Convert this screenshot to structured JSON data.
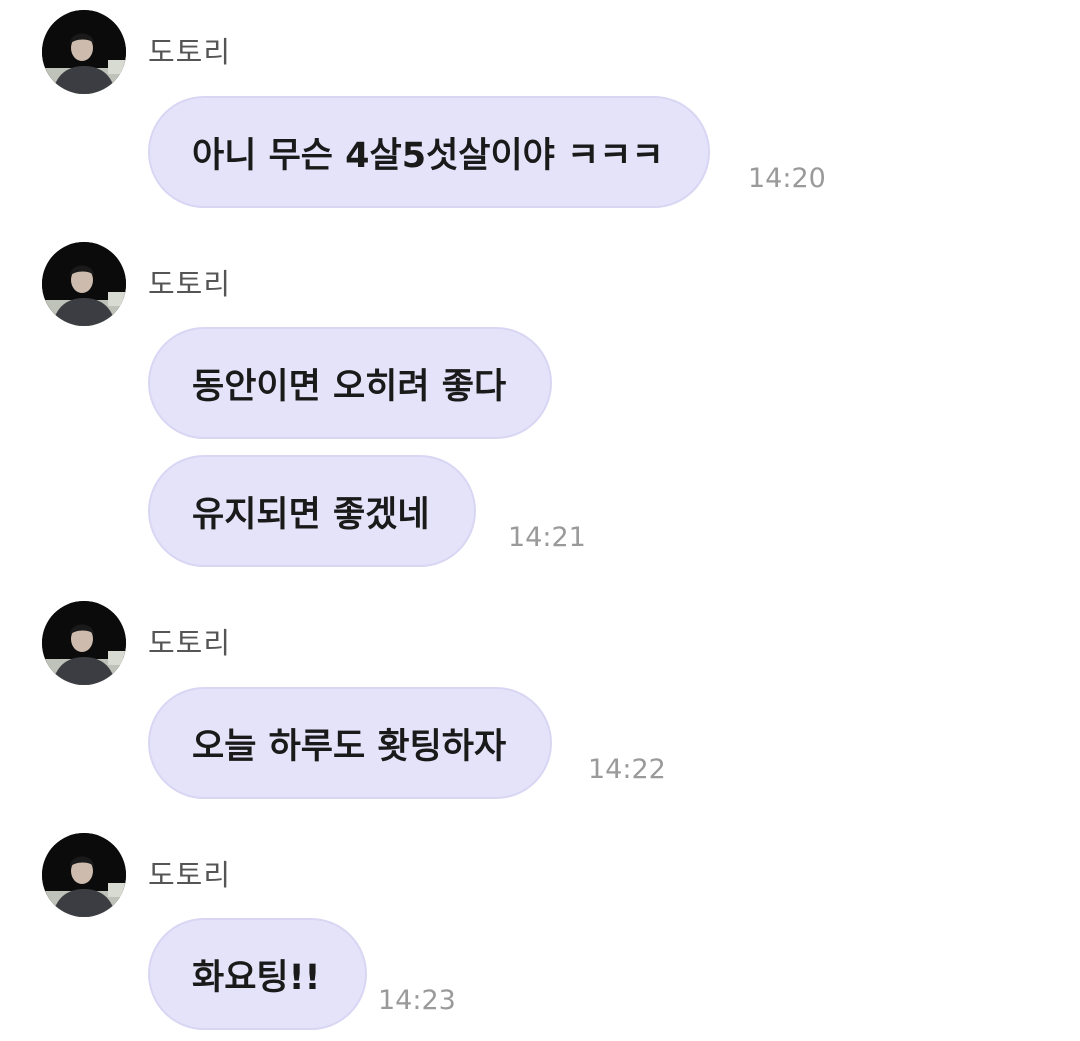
{
  "messages": [
    {
      "sender": "도토리",
      "bubbles": [
        {
          "text": "아니 무슨 4살5섯살이야 ㅋㅋㅋ",
          "time": "14:20"
        }
      ]
    },
    {
      "sender": "도토리",
      "bubbles": [
        {
          "text": "동안이면 오히려 좋다",
          "time": ""
        },
        {
          "text": "유지되면 좋겠네",
          "time": "14:21"
        }
      ]
    },
    {
      "sender": "도토리",
      "bubbles": [
        {
          "text": "오늘 하루도 홧팅하자",
          "time": "14:22"
        }
      ]
    },
    {
      "sender": "도토리",
      "bubbles": [
        {
          "text": "화요팅!!",
          "time": "14:23"
        }
      ]
    }
  ],
  "colors": {
    "bubble_bg": "#e5e3fa",
    "bubble_border": "#d9d6f4",
    "sender_text": "#555555",
    "time_text": "#9a9a9a"
  },
  "icons": {
    "avatar": "profile-photo"
  }
}
